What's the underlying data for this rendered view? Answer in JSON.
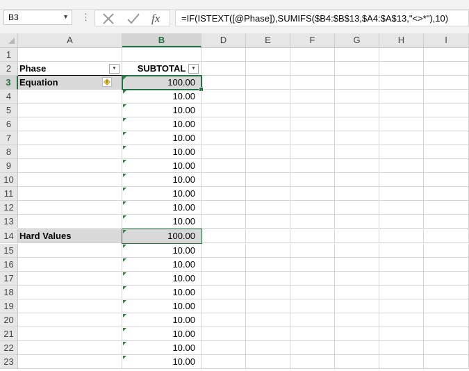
{
  "formula_bar": {
    "name_box": "B3",
    "formula": "=IF(ISTEXT([@Phase]),SUMIFS($B4:$B$13,$A4:$A$13,\"<>*\"),10)",
    "icons": [
      "cancel-icon",
      "enter-icon",
      "insert-function-icon"
    ]
  },
  "columns": [
    "A",
    "B",
    "D",
    "E",
    "F",
    "G",
    "H",
    "I"
  ],
  "table": {
    "headers": {
      "phase": "Phase",
      "subtotal": "SUBTOTAL"
    }
  },
  "rows": [
    {
      "num": "1",
      "a": "",
      "b": ""
    },
    {
      "num": "2",
      "a": "Phase",
      "b": "SUBTOTAL"
    },
    {
      "num": "3",
      "a": "Equation",
      "b": "100.00"
    },
    {
      "num": "4",
      "a": "",
      "b": "10.00"
    },
    {
      "num": "5",
      "a": "",
      "b": "10.00"
    },
    {
      "num": "6",
      "a": "",
      "b": "10.00"
    },
    {
      "num": "7",
      "a": "",
      "b": "10.00"
    },
    {
      "num": "8",
      "a": "",
      "b": "10.00"
    },
    {
      "num": "9",
      "a": "",
      "b": "10.00"
    },
    {
      "num": "10",
      "a": "",
      "b": "10.00"
    },
    {
      "num": "11",
      "a": "",
      "b": "10.00"
    },
    {
      "num": "12",
      "a": "",
      "b": "10.00"
    },
    {
      "num": "13",
      "a": "",
      "b": "10.00"
    },
    {
      "num": "14",
      "a": "Hard Values",
      "b": "100.00"
    },
    {
      "num": "15",
      "a": "",
      "b": "10.00"
    },
    {
      "num": "16",
      "a": "",
      "b": "10.00"
    },
    {
      "num": "17",
      "a": "",
      "b": "10.00"
    },
    {
      "num": "18",
      "a": "",
      "b": "10.00"
    },
    {
      "num": "19",
      "a": "",
      "b": "10.00"
    },
    {
      "num": "20",
      "a": "",
      "b": "10.00"
    },
    {
      "num": "21",
      "a": "",
      "b": "10.00"
    },
    {
      "num": "22",
      "a": "",
      "b": "10.00"
    },
    {
      "num": "23",
      "a": "",
      "b": "10.00"
    }
  ],
  "colors": {
    "accent": "#217346",
    "error_triangle": "#2a8a3e",
    "group_fill": "#d9d9d9"
  }
}
